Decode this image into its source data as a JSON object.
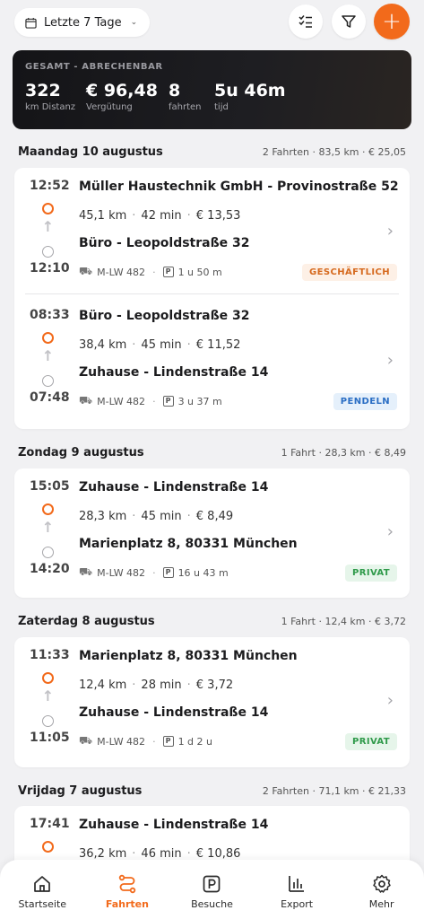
{
  "header": {
    "date_range": "Letzte 7 Tage",
    "add_label": "+"
  },
  "summary": {
    "label": "GESAMT - ABRECHENBAR",
    "stats": [
      {
        "value": "322",
        "sub": "km Distanz"
      },
      {
        "value": "€ 96,48",
        "sub": "Vergütung"
      },
      {
        "value": "8",
        "sub": "fahrten"
      },
      {
        "value": "5u 46m",
        "sub": "tijd"
      }
    ]
  },
  "days": [
    {
      "name": "Maandag 10 augustus",
      "meta": "2 Fahrten · 83,5 km · € 25,05",
      "trips": [
        {
          "time_start": "12:52",
          "time_end": "12:10",
          "from": "Müller Haustechnik GmbH - Provinostraße 52",
          "distance": "45,1 km",
          "duration": "42 min",
          "amount": "€ 13,53",
          "to": "Büro - Leopoldstraße 32",
          "plate": "M-LW 482",
          "parking": "1 u 50 m",
          "badge": "GESCHÄFTLICH"
        },
        {
          "time_start": "08:33",
          "time_end": "07:48",
          "from": "Büro - Leopoldstraße 32",
          "distance": "38,4 km",
          "duration": "45 min",
          "amount": "€ 11,52",
          "to": "Zuhause - Lindenstraße 14",
          "plate": "M-LW 482",
          "parking": "3 u 37 m",
          "badge": "PENDELN"
        }
      ]
    },
    {
      "name": "Zondag 9 augustus",
      "meta": "1 Fahrt · 28,3 km · € 8,49",
      "trips": [
        {
          "time_start": "15:05",
          "time_end": "14:20",
          "from": "Zuhause - Lindenstraße 14",
          "distance": "28,3 km",
          "duration": "45 min",
          "amount": "€ 8,49",
          "to": "Marienplatz 8, 80331 München",
          "plate": "M-LW 482",
          "parking": "16 u 43 m",
          "badge": "PRIVAT"
        }
      ]
    },
    {
      "name": "Zaterdag 8 augustus",
      "meta": "1 Fahrt · 12,4 km · € 3,72",
      "trips": [
        {
          "time_start": "11:33",
          "time_end": "11:05",
          "from": "Marienplatz 8, 80331 München",
          "distance": "12,4 km",
          "duration": "28 min",
          "amount": "€ 3,72",
          "to": "Zuhause - Lindenstraße 14",
          "plate": "M-LW 482",
          "parking": "1 d 2 u",
          "badge": "PRIVAT"
        }
      ]
    },
    {
      "name": "Vrijdag 7 augustus",
      "meta": "2 Fahrten · 71,1 km · € 21,33",
      "trips": [
        {
          "time_start": "17:41",
          "from": "Zuhause - Lindenstraße 14",
          "distance": "36,2 km",
          "duration": "46 min",
          "amount": "€ 10,86"
        }
      ]
    }
  ],
  "nav": {
    "items": [
      "Startseite",
      "Fahrten",
      "Besuche",
      "Export",
      "Mehr"
    ],
    "active": "Fahrten"
  },
  "colors": {
    "accent": "#f26a1b",
    "business": "#d66a1f",
    "commute": "#2a6ec4",
    "private": "#2f9a4a"
  }
}
